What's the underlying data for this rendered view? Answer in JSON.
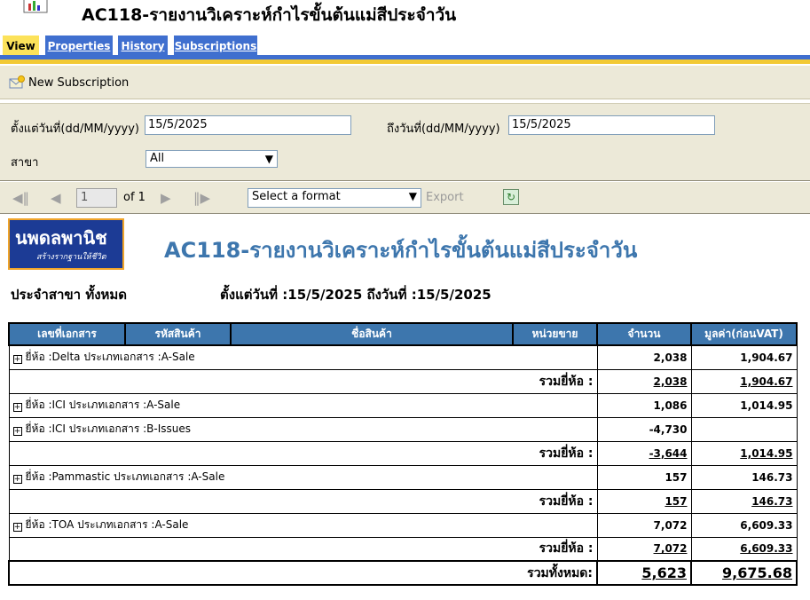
{
  "window": {
    "title": "AC118-รายงานวิเคราะห์กำไรขั้นต้นแม่สีประจำวัน"
  },
  "tabs": [
    {
      "label": "View",
      "active": true
    },
    {
      "label": "Properties",
      "active": false
    },
    {
      "label": "History",
      "active": false
    },
    {
      "label": "Subscriptions",
      "active": false
    }
  ],
  "toolbar": {
    "new_subscription_label": "New Subscription"
  },
  "params": {
    "from_label": "ตั้งแต่วันที่(dd/MM/yyyy)",
    "from_value": "15/5/2025",
    "to_label": "ถึงวันที่(dd/MM/yyyy)",
    "to_value": "15/5/2025",
    "branch_label": "สาขา",
    "branch_value": "All"
  },
  "report_toolbar": {
    "page_value": "1",
    "page_of": "of 1",
    "format_placeholder": "Select a format",
    "export_label": "Export"
  },
  "report": {
    "logo_text": "นพดลพานิช",
    "logo_tagline": "สร้างรากฐานให้ชีวิต",
    "title": "AC118-รายงานวิเคราะห์กำไรขั้นต้นแม่สีประจำวัน",
    "branch_line": "ประจำสาขา ทั้งหมด",
    "range_line": "ตั้งแต่วันที่ :15/5/2025 ถึงวันที่ :15/5/2025",
    "columns": [
      "เลขที่เอกสาร",
      "รหัสสินค้า",
      "ชื่อสินค้า",
      "หน่วยขาย",
      "จำนวน",
      "มูลค่า(ก่อนVAT)"
    ],
    "rows": [
      {
        "kind": "group",
        "label": "ยี่ห้อ :Delta ประเภทเอกสาร :A-Sale",
        "qty": "2,038",
        "amount": "1,904.67"
      },
      {
        "kind": "subtotal",
        "label": "รวมยี่ห้อ :",
        "qty": "2,038",
        "amount": "1,904.67"
      },
      {
        "kind": "group",
        "label": "ยี่ห้อ :ICI ประเภทเอกสาร :A-Sale",
        "qty": "1,086",
        "amount": "1,014.95"
      },
      {
        "kind": "group",
        "label": "ยี่ห้อ :ICI ประเภทเอกสาร :B-Issues",
        "qty": "-4,730",
        "amount": ""
      },
      {
        "kind": "subtotal",
        "label": "รวมยี่ห้อ :",
        "qty": "-3,644",
        "amount": "1,014.95"
      },
      {
        "kind": "group",
        "label": "ยี่ห้อ :Pammastic ประเภทเอกสาร :A-Sale",
        "qty": "157",
        "amount": "146.73"
      },
      {
        "kind": "subtotal",
        "label": "รวมยี่ห้อ :",
        "qty": "157",
        "amount": "146.73"
      },
      {
        "kind": "group",
        "label": "ยี่ห้อ :TOA ประเภทเอกสาร :A-Sale",
        "qty": "7,072",
        "amount": "6,609.33"
      },
      {
        "kind": "subtotal",
        "label": "รวมยี่ห้อ :",
        "qty": "7,072",
        "amount": "6,609.33"
      }
    ],
    "grand_total": {
      "label": "รวมทั้งหมด:",
      "qty": "5,623",
      "amount": "9,675.68"
    }
  }
}
